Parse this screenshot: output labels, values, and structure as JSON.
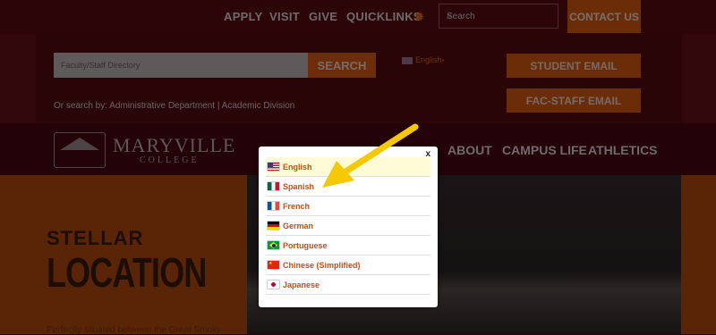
{
  "topbar": {
    "nav": [
      "APPLY",
      "VISIT",
      "GIVE",
      "QUICKLINKS"
    ],
    "search_placeholder": "Search",
    "contact_label": "CONTACT US"
  },
  "directory": {
    "placeholder": "Faculty/Staff Directory",
    "search_label": "SEARCH",
    "or_search_text": "Or search by: Administrative Department | Academic Division"
  },
  "language_selector": {
    "label": "English"
  },
  "email_buttons": {
    "student": "STUDENT EMAIL",
    "staff": "FAC-STAFF EMAIL"
  },
  "logo": {
    "name": "MARYVILLE",
    "sub": "COLLEGE"
  },
  "main_nav": [
    "ABOUT",
    "CAMPUS LIFE",
    "ATHLETICS"
  ],
  "hero": {
    "kicker": "STELLAR",
    "title": "LOCATION",
    "blurb": "Perfectly situated between the Great Smoky"
  },
  "modal": {
    "close_label": "x",
    "languages": [
      {
        "label": "English",
        "flag": "us-flag-icon",
        "selected": true
      },
      {
        "label": "Spanish",
        "flag": "mexico-flag-icon"
      },
      {
        "label": "French",
        "flag": "france-flag-icon"
      },
      {
        "label": "German",
        "flag": "germany-flag-icon"
      },
      {
        "label": "Portuguese",
        "flag": "brazil-flag-icon"
      },
      {
        "label": "Chinese (Simplified)",
        "flag": "china-flag-icon"
      },
      {
        "label": "Japanese",
        "flag": "japan-flag-icon"
      }
    ]
  },
  "colors": {
    "overlay_bg": "#2a0509",
    "accent_orange": "#d14a0b",
    "highlight_row": "#fffbd6",
    "arrow_yellow": "#f5c800"
  }
}
